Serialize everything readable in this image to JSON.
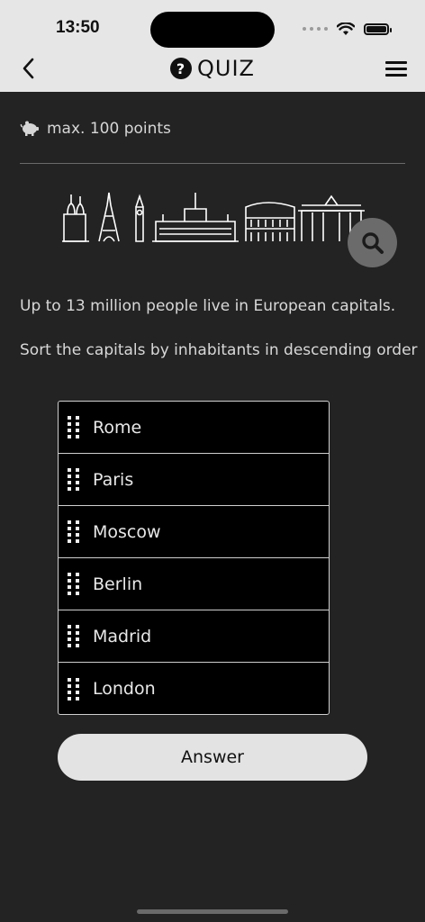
{
  "status": {
    "time": "13:50"
  },
  "nav": {
    "title": "QUIZ",
    "help_glyph": "?"
  },
  "quiz": {
    "points_label": "max. 100 points",
    "statement": "Up to 13 million people live in European capitals.",
    "instruction": "Sort the capitals by inhabitants in descending order",
    "items": [
      {
        "label": "Rome"
      },
      {
        "label": "Paris"
      },
      {
        "label": "Moscow"
      },
      {
        "label": "Berlin"
      },
      {
        "label": "Madrid"
      },
      {
        "label": "London"
      }
    ],
    "answer_label": "Answer"
  },
  "icons": {
    "back": "chevron-left-icon",
    "menu": "hamburger-icon",
    "points": "piggy-bank-icon",
    "search": "magnifier-icon"
  },
  "colors": {
    "background": "#232323",
    "topbar": "#e6e6e6",
    "list_bg": "#000000",
    "button": "#e3e3e3"
  }
}
